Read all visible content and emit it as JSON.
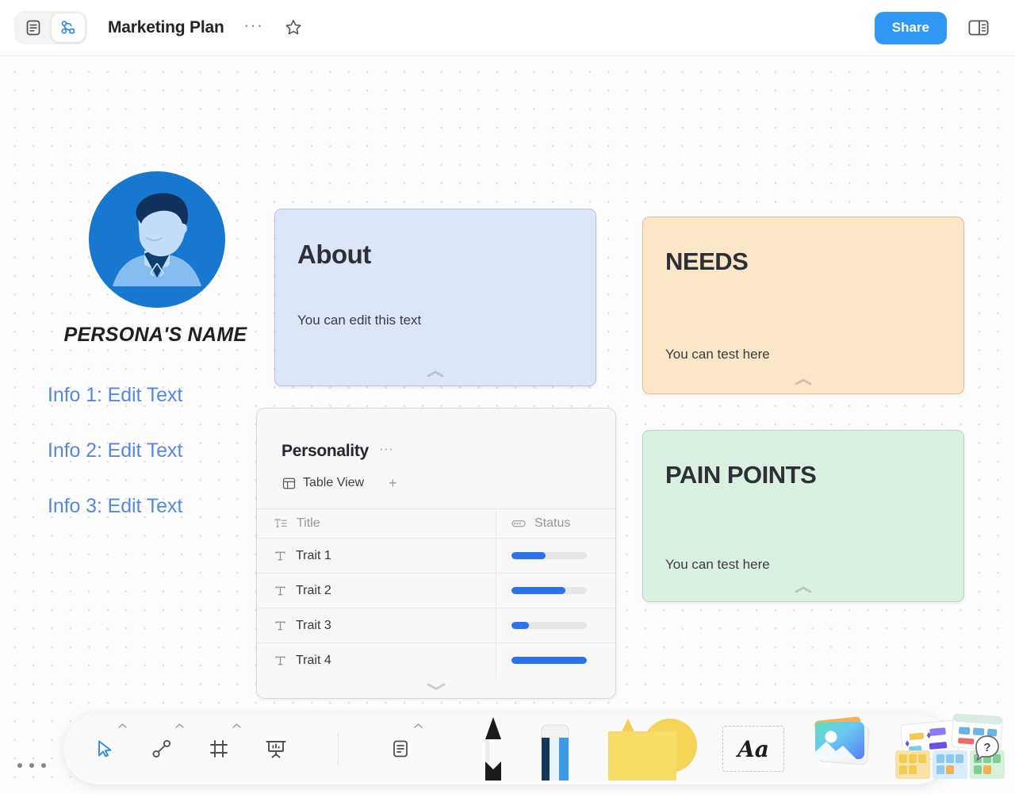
{
  "header": {
    "title": "Marketing Plan",
    "mode_page_icon": "page-mode-icon",
    "mode_edgeless_icon": "edgeless-mode-icon",
    "more_label": "···",
    "star_icon": "star-icon",
    "share_label": "Share",
    "right_panel_icon": "right-sidebar-icon"
  },
  "persona": {
    "avatar_icon": "persona-avatar",
    "name": "PERSONA'S NAME",
    "info": [
      "Info 1: Edit Text",
      "Info 2: Edit Text",
      "Info 3: Edit Text"
    ]
  },
  "cards": {
    "about": {
      "title": "About",
      "body": "You can edit this text",
      "bg": "#dbe7f9",
      "border": "#b6c5dc"
    },
    "needs": {
      "title": "NEEDS",
      "body": "You can test here",
      "bg": "#fbe7c8",
      "border": "#dbc29b"
    },
    "pain_points": {
      "title": "PAIN POINTS",
      "body": "You can test here",
      "bg": "#daf0e1",
      "border": "#b8d5c1"
    }
  },
  "database": {
    "title": "Personality",
    "more_label": "···",
    "view_tab_label": "Table View",
    "view_tab_icon": "table-view-icon",
    "add_view_label": "+",
    "columns": [
      {
        "label": "Title",
        "icon": "title-column-icon"
      },
      {
        "label": "Status",
        "icon": "progress-column-icon"
      }
    ],
    "rows": [
      {
        "icon": "text-cell-icon",
        "title": "Trait 1",
        "progress": 45
      },
      {
        "icon": "text-cell-icon",
        "title": "Trait 2",
        "progress": 72
      },
      {
        "icon": "text-cell-icon",
        "title": "Trait 3",
        "progress": 23
      },
      {
        "icon": "text-cell-icon",
        "title": "Trait 4",
        "progress": 100
      }
    ],
    "accent": "#2c72eb"
  },
  "toolbar": {
    "tools": [
      {
        "name": "select-tool",
        "icon": "cursor-icon",
        "active": true
      },
      {
        "name": "connector-tool",
        "icon": "connector-icon",
        "active": false
      },
      {
        "name": "frame-tool",
        "icon": "frame-icon",
        "active": false
      },
      {
        "name": "present-tool",
        "icon": "presentation-icon",
        "active": false
      },
      {
        "name": "note-tool",
        "icon": "note-icon",
        "active": false
      }
    ],
    "big_tools": [
      {
        "name": "pen-tool",
        "icon": "pencil-icon"
      },
      {
        "name": "eraser-tool",
        "icon": "eraser-icon"
      },
      {
        "name": "shape-tool",
        "icon": "shapes-icon"
      },
      {
        "name": "text-tool",
        "icon": "text-aa-icon",
        "label": "Aa"
      },
      {
        "name": "image-tool",
        "icon": "image-icon"
      },
      {
        "name": "template-tool",
        "icon": "templates-icon"
      }
    ],
    "help_label": "?",
    "corner_menu_label": "···"
  }
}
